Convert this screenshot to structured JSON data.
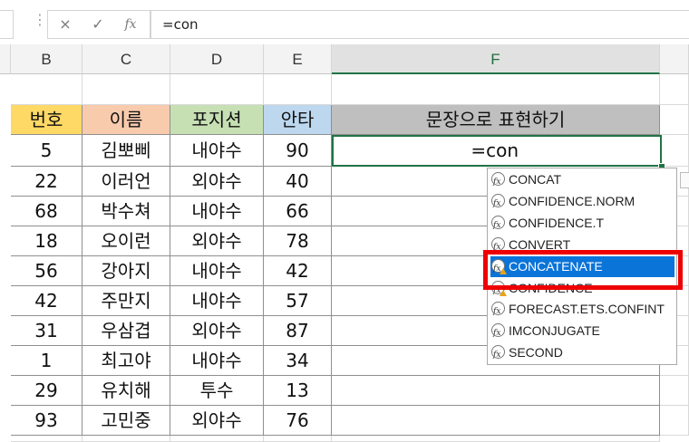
{
  "formula_bar": {
    "cancel_icon": "×",
    "enter_icon": "✓",
    "fx_label": "fx",
    "value": "=con"
  },
  "columns": [
    "B",
    "C",
    "D",
    "E",
    "F"
  ],
  "table": {
    "headers": [
      "번호",
      "이름",
      "포지션",
      "안타",
      "문장으로 표현하기"
    ],
    "header_colors": [
      "#ffd966",
      "#f8cbad",
      "#c6e0b4",
      "#bdd7ee",
      "#bfbfbf"
    ],
    "rows": [
      [
        "5",
        "김뽀삐",
        "내야수",
        "90"
      ],
      [
        "22",
        "이러언",
        "외야수",
        "40"
      ],
      [
        "68",
        "박수쳐",
        "내야수",
        "66"
      ],
      [
        "18",
        "오이런",
        "외야수",
        "78"
      ],
      [
        "56",
        "강아지",
        "내야수",
        "42"
      ],
      [
        "42",
        "주만지",
        "내야수",
        "57"
      ],
      [
        "31",
        "우삼겹",
        "외야수",
        "87"
      ],
      [
        "1",
        "최고야",
        "내야수",
        "34"
      ],
      [
        "29",
        "유치해",
        "투수",
        "13"
      ],
      [
        "93",
        "고민중",
        "외야수",
        "76"
      ]
    ]
  },
  "active_cell": {
    "value": "=con"
  },
  "autocomplete": {
    "items": [
      {
        "label": "CONCAT",
        "icon": "function-icon"
      },
      {
        "label": "CONFIDENCE.NORM",
        "icon": "function-icon"
      },
      {
        "label": "CONFIDENCE.T",
        "icon": "function-icon"
      },
      {
        "label": "CONVERT",
        "icon": "function-icon"
      },
      {
        "label": "CONCATENATE",
        "icon": "function-warning-icon",
        "selected": true
      },
      {
        "label": "CONFIDENCE",
        "icon": "function-warning-icon"
      },
      {
        "label": "FORECAST.ETS.CONFINT",
        "icon": "function-icon"
      },
      {
        "label": "IMCONJUGATE",
        "icon": "function-icon"
      },
      {
        "label": "SECOND",
        "icon": "function-icon"
      }
    ]
  },
  "colors": {
    "accent": "#217346",
    "selection": "#0a74d9",
    "highlight_box": "#ee0000"
  }
}
